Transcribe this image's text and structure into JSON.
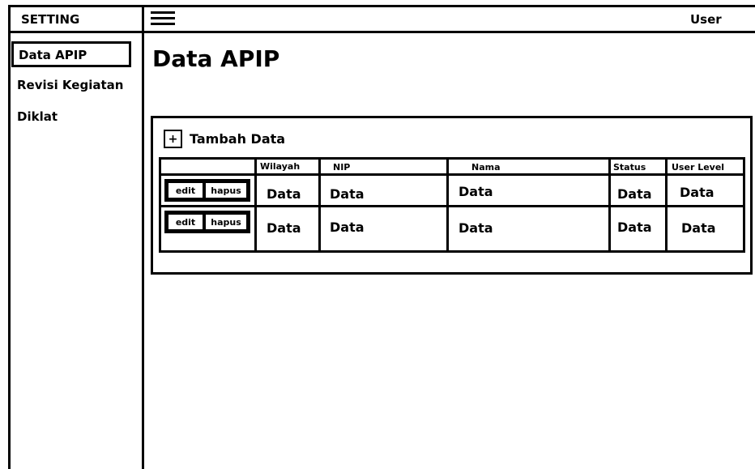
{
  "header": {
    "brand": "SETTING",
    "user": "User"
  },
  "sidebar": {
    "items": [
      {
        "label": "Data APIP"
      },
      {
        "label": "Revisi Kegiatan"
      },
      {
        "label": "Diklat"
      }
    ]
  },
  "main": {
    "title": "Data APIP",
    "add_button": {
      "icon": "+",
      "label": "Tambah Data"
    },
    "table": {
      "headers": [
        "",
        "Wilayah",
        "NIP",
        "Nama",
        "Status",
        "User Level"
      ],
      "rows": [
        {
          "edit": "edit",
          "hapus": "hapus",
          "cells": [
            "Data",
            "Data",
            "Data",
            "Data",
            "Data"
          ]
        },
        {
          "edit": "edit",
          "hapus": "hapus",
          "cells": [
            "Data",
            "Data",
            "Data",
            "Data",
            "Data"
          ]
        }
      ]
    }
  }
}
